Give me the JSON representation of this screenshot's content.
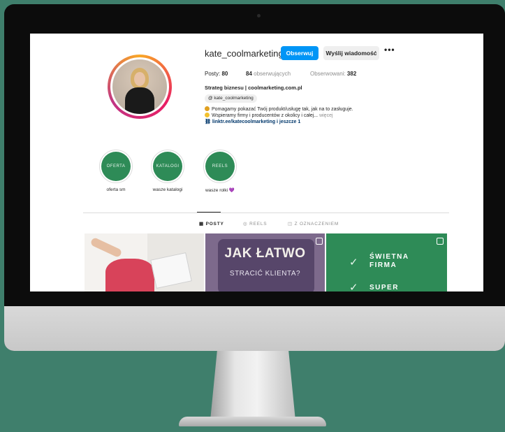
{
  "profile": {
    "username": "kate_coolmarketing",
    "follow_label": "Obserwuj",
    "message_label": "Wyślij wiadomość",
    "more_label": "•••",
    "posts_label": "Posty:",
    "posts_count": "80",
    "followers_count": "84",
    "followers_label": "obserwujących",
    "following_label": "Obserwowani:",
    "following_count": "382",
    "bio_name": "Strateg biznesu | coolmarketing.com.pl",
    "threads_handle": "kate_coolmarketing",
    "bio_line1": "Pomagamy pokazać Twój produkt/usługę tak, jak na to zasługuje.",
    "bio_line2": "Wspieramy firmy i producentów z okolicy i całej...",
    "more_link": "więcej",
    "link_text": "linktr.ee/katecoolmarketing i jeszcze 1"
  },
  "highlights": [
    {
      "cover_text": "OFERTA",
      "label": "oferta sm"
    },
    {
      "cover_text": "KATALOGI",
      "label": "wasze katalogi"
    },
    {
      "cover_text": "REELS",
      "label": "wasze rolki 💜"
    }
  ],
  "tabs": [
    {
      "label": "POSTY",
      "icon": "grid-icon"
    },
    {
      "label": "REELS",
      "icon": "reels-icon"
    },
    {
      "label": "Z OZNACZENIEM",
      "icon": "tagged-icon"
    }
  ],
  "posts": {
    "post2_title": "JAK ŁATWO",
    "post2_subtitle": "STRACIĆ KLIENTA?",
    "post3_line1a": "ŚWIETNA",
    "post3_line1b": "FIRMA",
    "post3_line2": "SUPER"
  },
  "colors": {
    "background": "#3f7f6c",
    "follow_button": "#0095f6",
    "brand_green": "#2e8b57"
  }
}
